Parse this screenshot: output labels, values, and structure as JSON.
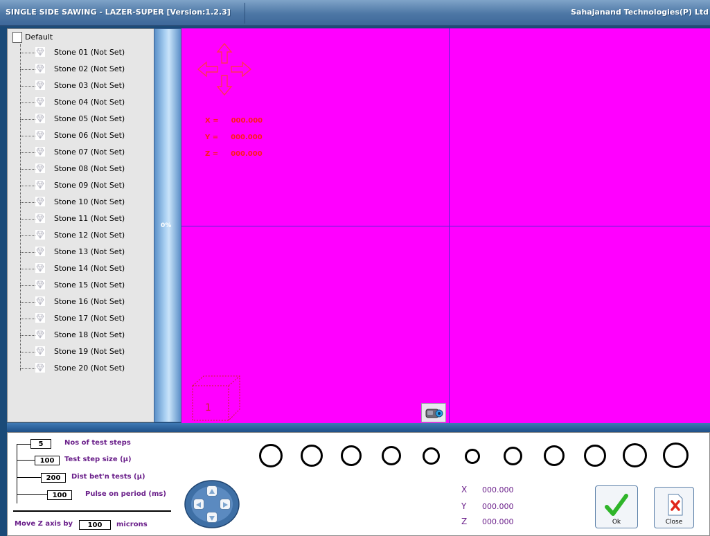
{
  "window": {
    "title": "SINGLE SIDE SAWING - LAZER-SUPER [Version:1.2.3]",
    "company": "Sahajanand Technologies(P) Ltd"
  },
  "tree": {
    "root": "Default",
    "items": [
      "Stone 01  (Not Set)",
      "Stone 02  (Not Set)",
      "Stone 03  (Not Set)",
      "Stone 04  (Not Set)",
      "Stone 05  (Not Set)",
      "Stone 06  (Not Set)",
      "Stone 07  (Not Set)",
      "Stone 08  (Not Set)",
      "Stone 09  (Not Set)",
      "Stone 10  (Not Set)",
      "Stone 11  (Not Set)",
      "Stone 12  (Not Set)",
      "Stone 13  (Not Set)",
      "Stone 14  (Not Set)",
      "Stone 15  (Not Set)",
      "Stone 16  (Not Set)",
      "Stone 17  (Not Set)",
      "Stone 18  (Not Set)",
      "Stone 19  (Not Set)",
      "Stone 20  (Not Set)"
    ]
  },
  "progress": {
    "text": "0%",
    "value": 0
  },
  "camera": {
    "x_label": "X =",
    "x_value": "000.000",
    "y_label": "Y =",
    "y_value": "000.000",
    "z_label": "Z =",
    "z_value": "000.000",
    "cube_number": "1",
    "background": "#ff00ff",
    "crosshair": "#4b2bd1"
  },
  "params": {
    "test_steps": {
      "value": "5",
      "label": "Nos of test steps"
    },
    "step_size": {
      "value": "100",
      "label": "Test step size (µ)"
    },
    "dist_tests": {
      "value": "200",
      "label": "Dist bet'n tests (µ)"
    },
    "pulse_on": {
      "value": "100",
      "label": "Pulse on period (ms)"
    },
    "move_z": {
      "prefix": "Move Z axis by",
      "value": "100",
      "suffix": "microns"
    }
  },
  "position": {
    "x_label": "X",
    "x_value": "000.000",
    "y_label": "Y",
    "y_value": "000.000",
    "z_label": "Z",
    "z_value": "000.000"
  },
  "buttons": {
    "ok": "Ok",
    "close": "Close"
  }
}
